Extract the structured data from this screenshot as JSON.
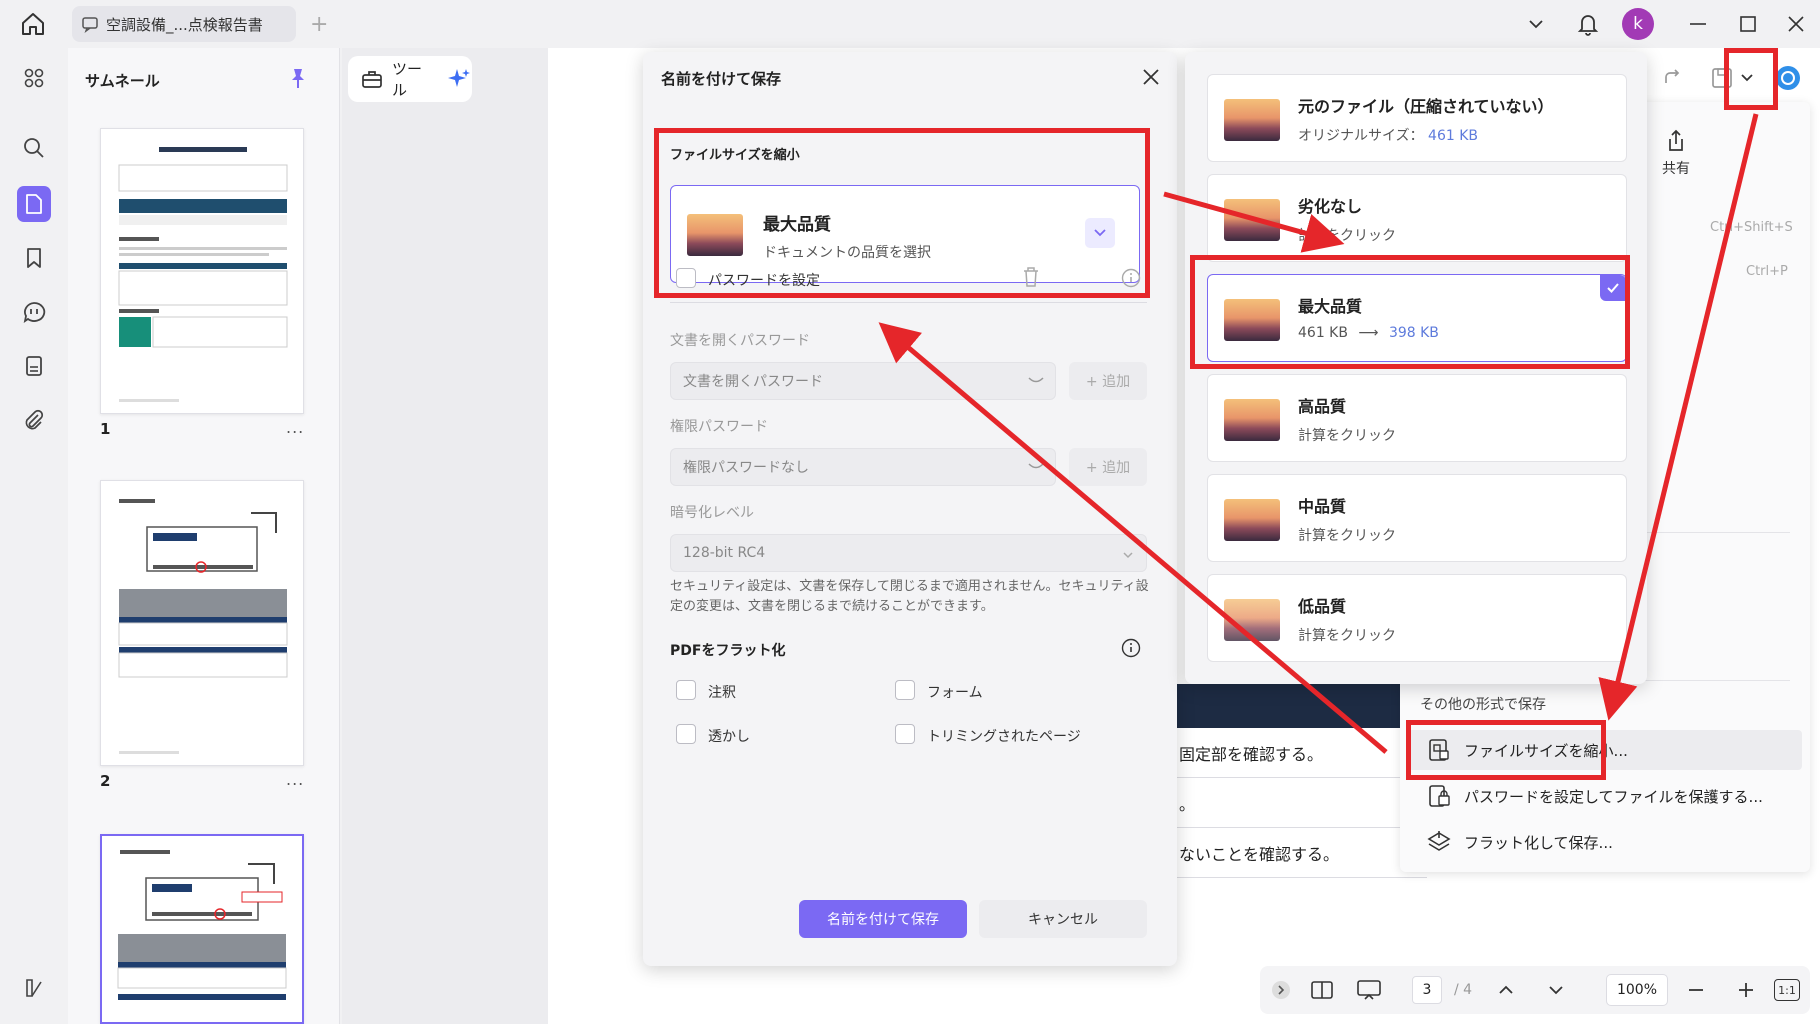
{
  "tab": {
    "title": "空調設備_...点検報告書"
  },
  "avatar": {
    "initial": "k"
  },
  "sidebar": {
    "thumb_title": "サムネール",
    "pages": [
      "1",
      "2"
    ],
    "more": "..."
  },
  "toolbar": {
    "tools_label": "ツール"
  },
  "dialog": {
    "title": "名前を付けて保存",
    "reduce_section": "ファイルサイズを縮小",
    "selected_quality": "最大品質",
    "selected_sub": "ドキュメントの品質を選択",
    "password_label": "パスワードを設定",
    "open_pw_label": "文書を開くパスワード",
    "open_pw_value": "文書を開くパスワード",
    "add": "+ 追加",
    "perm_pw_label": "権限パスワード",
    "perm_pw_value": "権限パスワードなし",
    "enc_label": "暗号化レベル",
    "enc_value": "128-bit RC4",
    "note": "セキュリティ設定は、文書を保存して閉じるまで適用されません。セキュリティ設定の変更は、文書を閉じるまで続けることができます。",
    "flatten_label": "PDFをフラット化",
    "flatten_items": [
      "注釈",
      "フォーム",
      "透かし",
      "トリミングされたページ"
    ],
    "save": "名前を付けて保存",
    "cancel": "キャンセル"
  },
  "quality_options": [
    {
      "title": "元のファイル（圧縮されていない）",
      "sub_prefix": "オリジナルサイズ：",
      "sub_hl": "461 KB"
    },
    {
      "title": "劣化なし",
      "sub": "計算をクリック"
    },
    {
      "title": "最大品質",
      "sub_prefix": "461 KB",
      "arrow": "⟶",
      "sub_hl": "398 KB"
    },
    {
      "title": "高品質",
      "sub": "計算をクリック"
    },
    {
      "title": "中品質",
      "sub": "計算をクリック"
    },
    {
      "title": "低品質",
      "sub": "計算をクリック"
    }
  ],
  "menu": {
    "share": "共有",
    "shortcut1": "Ctrl+Shift+S",
    "shortcut2": "Ctrl+P",
    "other_formats": "その他の形式で保存",
    "reduce": "ファイルサイズを縮小...",
    "protect": "パスワードを設定してファイルを保護する...",
    "flatten": "フラット化して保存..."
  },
  "document": {
    "row1": "固定部を確認する。",
    "row2": "。",
    "row3": "ないことを確認する。"
  },
  "bottom": {
    "page": "3",
    "total": "/ 4",
    "zoom": "100%",
    "fit": "1:1"
  },
  "colors": {
    "accent": "#7b69f3",
    "annotation": "#e5262a",
    "link": "#5e7bdc"
  }
}
